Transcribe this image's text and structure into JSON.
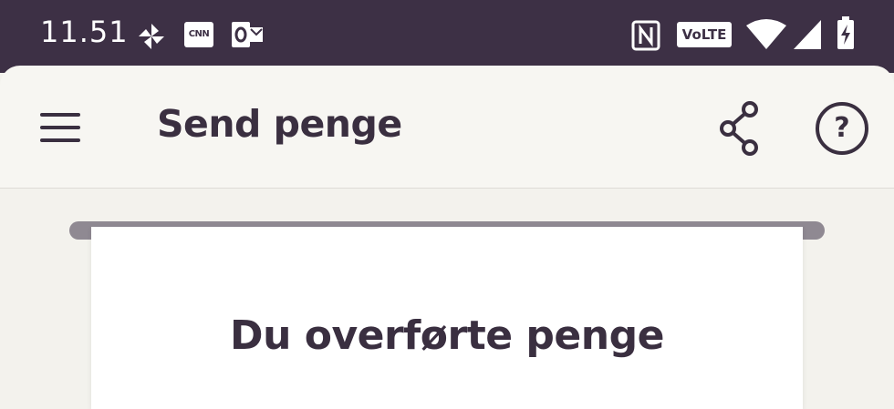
{
  "status_bar": {
    "time": "11.51",
    "left_icons": [
      "pinwheel-icon",
      "cnn-icon",
      "outlook-icon"
    ],
    "right_icons": [
      "nfc-icon",
      "volte-icon",
      "wifi-icon",
      "signal-icon",
      "battery-charging-icon"
    ],
    "cnn_label": "CNN",
    "volte_label": "VoLTE"
  },
  "app_bar": {
    "title": "Send penge",
    "menu_icon": "hamburger-menu-icon",
    "share_icon": "share-icon",
    "help_icon": "help-icon",
    "help_label": "?"
  },
  "receipt": {
    "heading": "Du overførte penge"
  },
  "colors": {
    "status_bar_bg": "#3d3045",
    "app_bar_bg": "#f7f6f2",
    "page_bg": "#f3f2ed",
    "text_primary": "#3a2f40",
    "rail": "#8f8992"
  }
}
